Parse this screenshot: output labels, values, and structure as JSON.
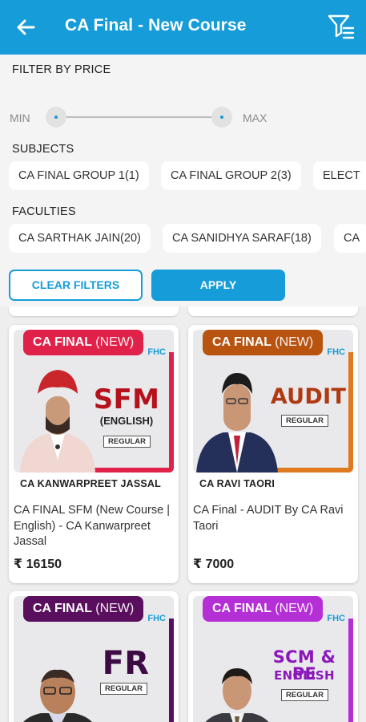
{
  "appbar": {
    "title": "CA Final - New Course",
    "back_icon": "back-arrow-icon",
    "filter_icon": "filter-list-icon",
    "color": "#169cd8"
  },
  "filters": {
    "price_label": "FILTER BY PRICE",
    "min_label": "MIN",
    "max_label": "MAX",
    "subjects_label": "SUBJECTS",
    "subjects": [
      "CA FINAL GROUP 1(1)",
      "CA FINAL GROUP 2(3)",
      "ELECT"
    ],
    "faculties_label": "FACULTIES",
    "faculties": [
      "CA SARTHAK JAIN(20)",
      "CA SANIDHYA SARAF(18)",
      "CA"
    ],
    "clear_label": "CLEAR FILTERS",
    "apply_label": "APPLY"
  },
  "courses": [
    {
      "badge_main": "CA FINAL",
      "badge_new": "(NEW)",
      "badge_color": "#e02149",
      "brand": "FHC",
      "subject": "SFM",
      "subject_sub": "(ENGLISH)",
      "regular": "REGULAR",
      "instructor": "CA KANWARPREET JASSAL",
      "title": "CA  FINAL SFM (New Course | English) - CA Kanwarpreet Jassal",
      "price": "₹ 16150"
    },
    {
      "badge_main": "CA FINAL",
      "badge_new": "(NEW)",
      "badge_color": "#b85410",
      "brand": "FHC",
      "subject": "AUDIT",
      "subject_sub": "",
      "regular": "REGULAR",
      "instructor": "CA RAVI TAORI",
      "title": "CA Final - AUDIT By CA Ravi Taori",
      "price": "₹ 7000"
    },
    {
      "badge_main": "CA FINAL",
      "badge_new": "(NEW)",
      "badge_color": "#5a0f5e",
      "brand": "FHC",
      "subject": "FR",
      "subject_sub": "",
      "regular": "REGULAR"
    },
    {
      "badge_main": "CA FINAL",
      "badge_new": "(NEW)",
      "badge_color": "#b52fd6",
      "brand": "FHC",
      "subject": "SCM & PE",
      "subject_sub": "ENGLISH",
      "regular": "REGULAR"
    }
  ]
}
